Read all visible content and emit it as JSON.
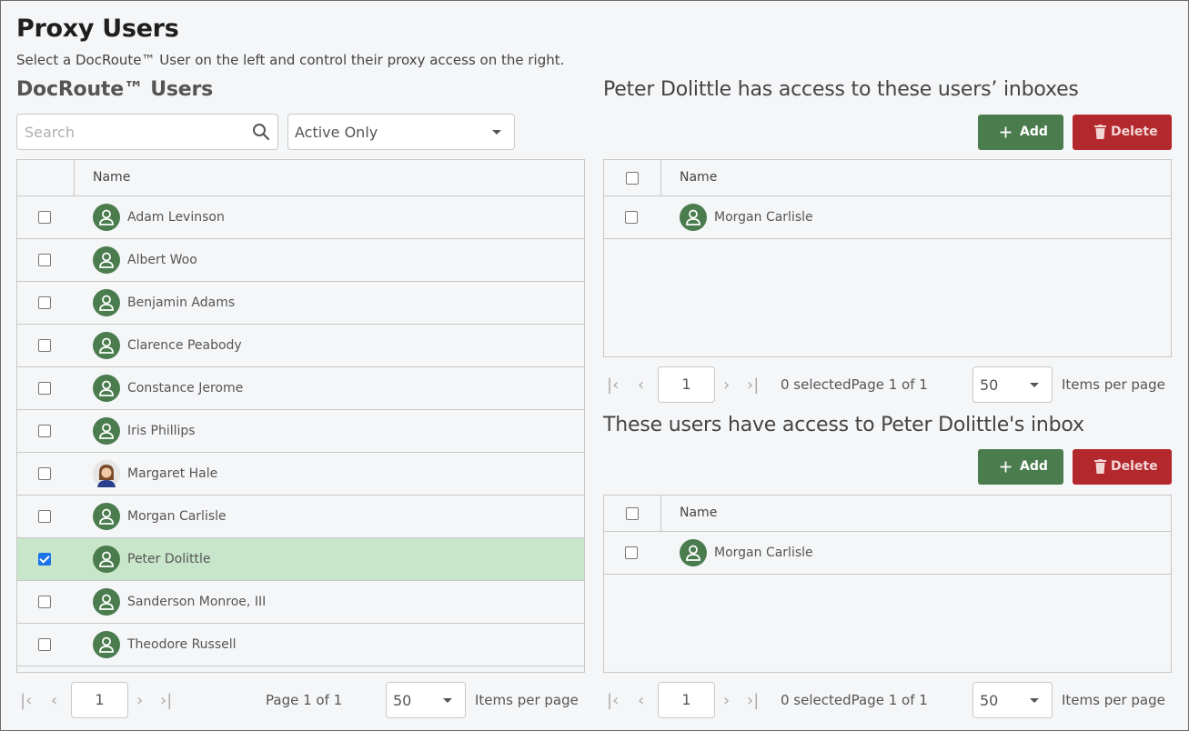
{
  "header": {
    "title": "Proxy Users",
    "subtitle": "Select a DocRoute™ User on the left and control their proxy access on the right."
  },
  "left": {
    "title": "DocRoute™ Users",
    "search": {
      "placeholder": "Search",
      "value": ""
    },
    "filter": {
      "selected": "Active Only"
    },
    "column_name": "Name",
    "users": [
      {
        "name": "Adam Levinson",
        "checked": false
      },
      {
        "name": "Albert Woo",
        "checked": false
      },
      {
        "name": "Benjamin Adams",
        "checked": false
      },
      {
        "name": "Clarence Peabody",
        "checked": false
      },
      {
        "name": "Constance Jerome",
        "checked": false
      },
      {
        "name": "Iris Phillips",
        "checked": false
      },
      {
        "name": "Margaret Hale",
        "checked": false,
        "photo": true
      },
      {
        "name": "Morgan Carlisle",
        "checked": false
      },
      {
        "name": "Peter Dolittle",
        "checked": true
      },
      {
        "name": "Sanderson Monroe, III",
        "checked": false
      },
      {
        "name": "Theodore Russell",
        "checked": false
      }
    ],
    "pager": {
      "page": "1",
      "page_info": "Page 1 of 1",
      "per_page": "50",
      "per_page_label": "Items per page"
    }
  },
  "top_right": {
    "title": "Peter Dolittle has access to these users’ inboxes",
    "add_label": "Add",
    "delete_label": "Delete",
    "column_name": "Name",
    "users": [
      {
        "name": "Morgan Carlisle"
      }
    ],
    "pager": {
      "page": "1",
      "selected_info": "0 selected",
      "page_info": "Page 1 of 1",
      "per_page": "50",
      "per_page_label": "Items per page"
    }
  },
  "bottom_right": {
    "title": "These users have access to Peter Dolittle's inbox",
    "add_label": "Add",
    "delete_label": "Delete",
    "column_name": "Name",
    "users": [
      {
        "name": "Morgan Carlisle"
      }
    ],
    "pager": {
      "page": "1",
      "selected_info": "0 selected",
      "page_info": "Page 1 of 1",
      "per_page": "50",
      "per_page_label": "Items per page"
    }
  },
  "colors": {
    "accent_green": "#4a7c4e",
    "danger_red": "#b3282d",
    "selected_row": "#c8e6c9"
  }
}
